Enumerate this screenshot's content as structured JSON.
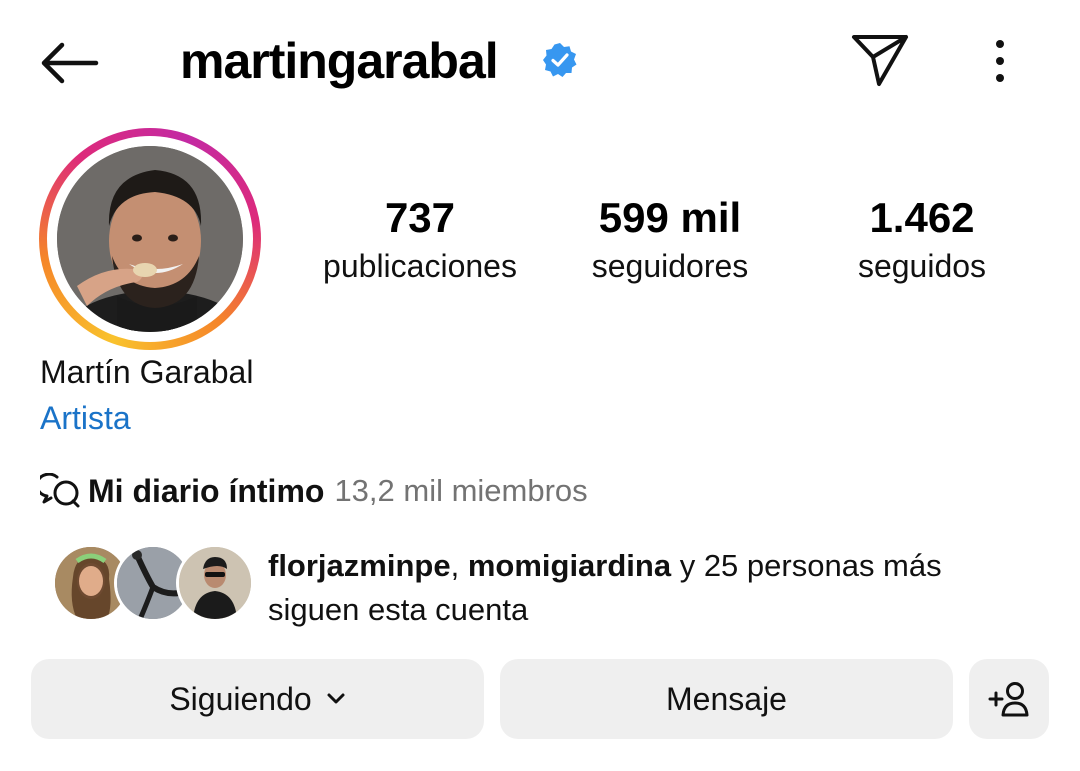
{
  "header": {
    "username": "martingarabal",
    "icons": {
      "back": "arrow-left-icon",
      "verified": "verified-badge-icon",
      "send": "paper-plane-icon",
      "more": "more-vertical-icon"
    }
  },
  "profile": {
    "full_name": "Martín Garabal",
    "category": "Artista",
    "category_color": "#1a73c8",
    "stats": {
      "posts": {
        "value": "737",
        "label": "publicaciones"
      },
      "followers": {
        "value": "599 mil",
        "label": "seguidores"
      },
      "following": {
        "value": "1.462",
        "label": "seguidos"
      }
    }
  },
  "channel": {
    "icon": "broadcast-chat-icon",
    "name": "Mi diario íntimo",
    "members": "13,2 mil miembros"
  },
  "followed_by": {
    "user1": "florjazminpe",
    "separator": ", ",
    "user2": "momigiardina",
    "rest": " y 25 personas más",
    "line2": "siguen esta cuenta"
  },
  "actions": {
    "following_label": "Siguiendo",
    "message_label": "Mensaje",
    "add_user_icon": "add-person-icon"
  },
  "colors": {
    "button_bg": "#efefef",
    "verified_blue": "#3797f0",
    "muted_text": "#737373"
  }
}
